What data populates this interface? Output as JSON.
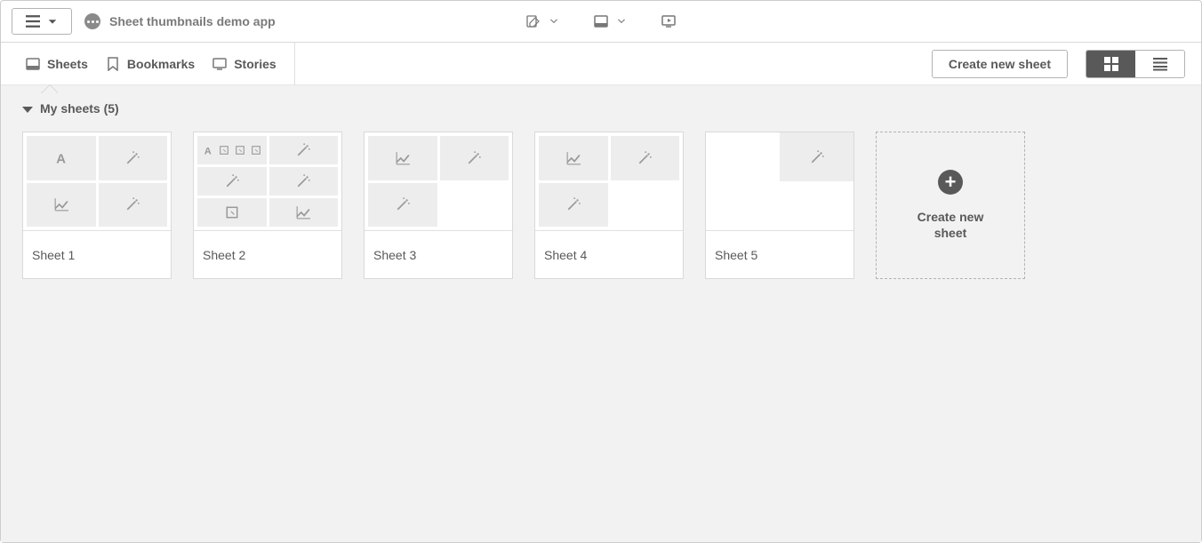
{
  "header": {
    "app_title": "Sheet thumbnails demo app"
  },
  "subnav": {
    "sheets_label": "Sheets",
    "bookmarks_label": "Bookmarks",
    "stories_label": "Stories",
    "create_button": "Create new sheet"
  },
  "section": {
    "title": "My sheets (5)"
  },
  "sheets": [
    {
      "label": "Sheet 1"
    },
    {
      "label": "Sheet 2"
    },
    {
      "label": "Sheet 3"
    },
    {
      "label": "Sheet 4"
    },
    {
      "label": "Sheet 5"
    }
  ],
  "create_card": {
    "label": "Create new sheet"
  }
}
